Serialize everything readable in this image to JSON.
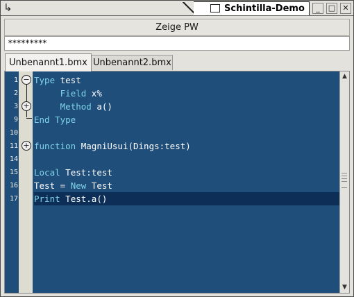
{
  "window": {
    "title": "Schintilla-Demo",
    "corner_glyph": "↳",
    "buttons": {
      "minimize": "_",
      "maximize": "□",
      "close": "✕"
    }
  },
  "toolbar": {
    "button_label": "Zeige PW"
  },
  "password_field": {
    "value": "*********"
  },
  "tabs": [
    {
      "label": "Unbenannt1.bmx",
      "active": true
    },
    {
      "label": "Unbenannt2.bmx",
      "active": false
    }
  ],
  "editor": {
    "colors": {
      "background": "#1f4e7b",
      "keyword": "#7fd3e8",
      "text": "#ffffff",
      "selected_line": "#0d2f57"
    },
    "lines": [
      {
        "number": "1",
        "fold": "−"
      },
      {
        "number": "2",
        "fold": ""
      },
      {
        "number": "3",
        "fold": "+"
      },
      {
        "number": "9",
        "fold": ""
      },
      {
        "number": "10",
        "fold": ""
      },
      {
        "number": "11",
        "fold": "+"
      },
      {
        "number": "14",
        "fold": ""
      },
      {
        "number": "15",
        "fold": ""
      },
      {
        "number": "16",
        "fold": ""
      },
      {
        "number": "17",
        "fold": ""
      }
    ],
    "code": {
      "l1_kw": "Type",
      "l1_rest": " test",
      "l2_indent": "     ",
      "l2_kw": "Field",
      "l2_rest": " x%",
      "l3_indent": "     ",
      "l3_kw": "Method",
      "l3_rest": " a()",
      "l9_kw": "End Type",
      "l11_kw": "function",
      "l11_rest": " MagniUsui(Dings:test)",
      "l15_kw": "Local",
      "l15_rest": " Test:test",
      "l16_a": "Test = ",
      "l16_kw": "New",
      "l16_rest": " Test",
      "l17_kw": "Print",
      "l17_rest": " Test.a()"
    }
  },
  "scrollbar": {
    "up_arrow": "▲",
    "down_arrow": "▼"
  }
}
